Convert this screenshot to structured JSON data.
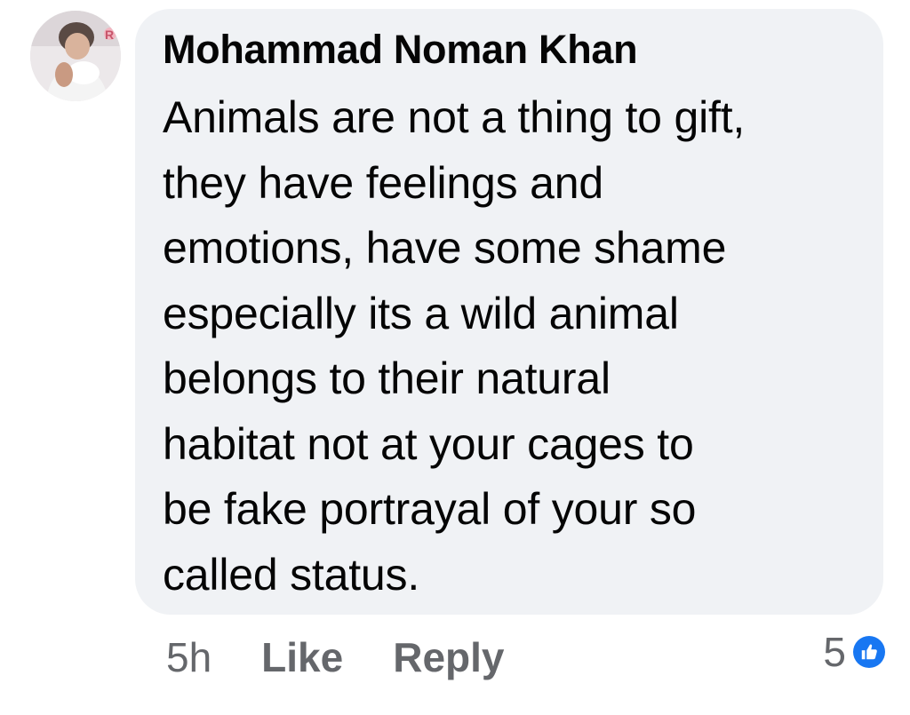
{
  "comment": {
    "author": "Mohammad Noman Khan",
    "text": "Animals are not a thing to gift,\nthey have feelings and\nemotions, have some shame\nespecially its a wild animal\nbelongs to their natural\nhabitat not at your cages to\nbe fake portrayal of your so\ncalled status.",
    "avatar_icon": "profile-photo",
    "bubble_color": "#f0f2f5"
  },
  "actions": {
    "time": "5h",
    "like_label": "Like",
    "reply_label": "Reply"
  },
  "reactions": {
    "count": "5",
    "icon": "like-thumbs-up-icon",
    "badge_color": "#1877f2"
  }
}
